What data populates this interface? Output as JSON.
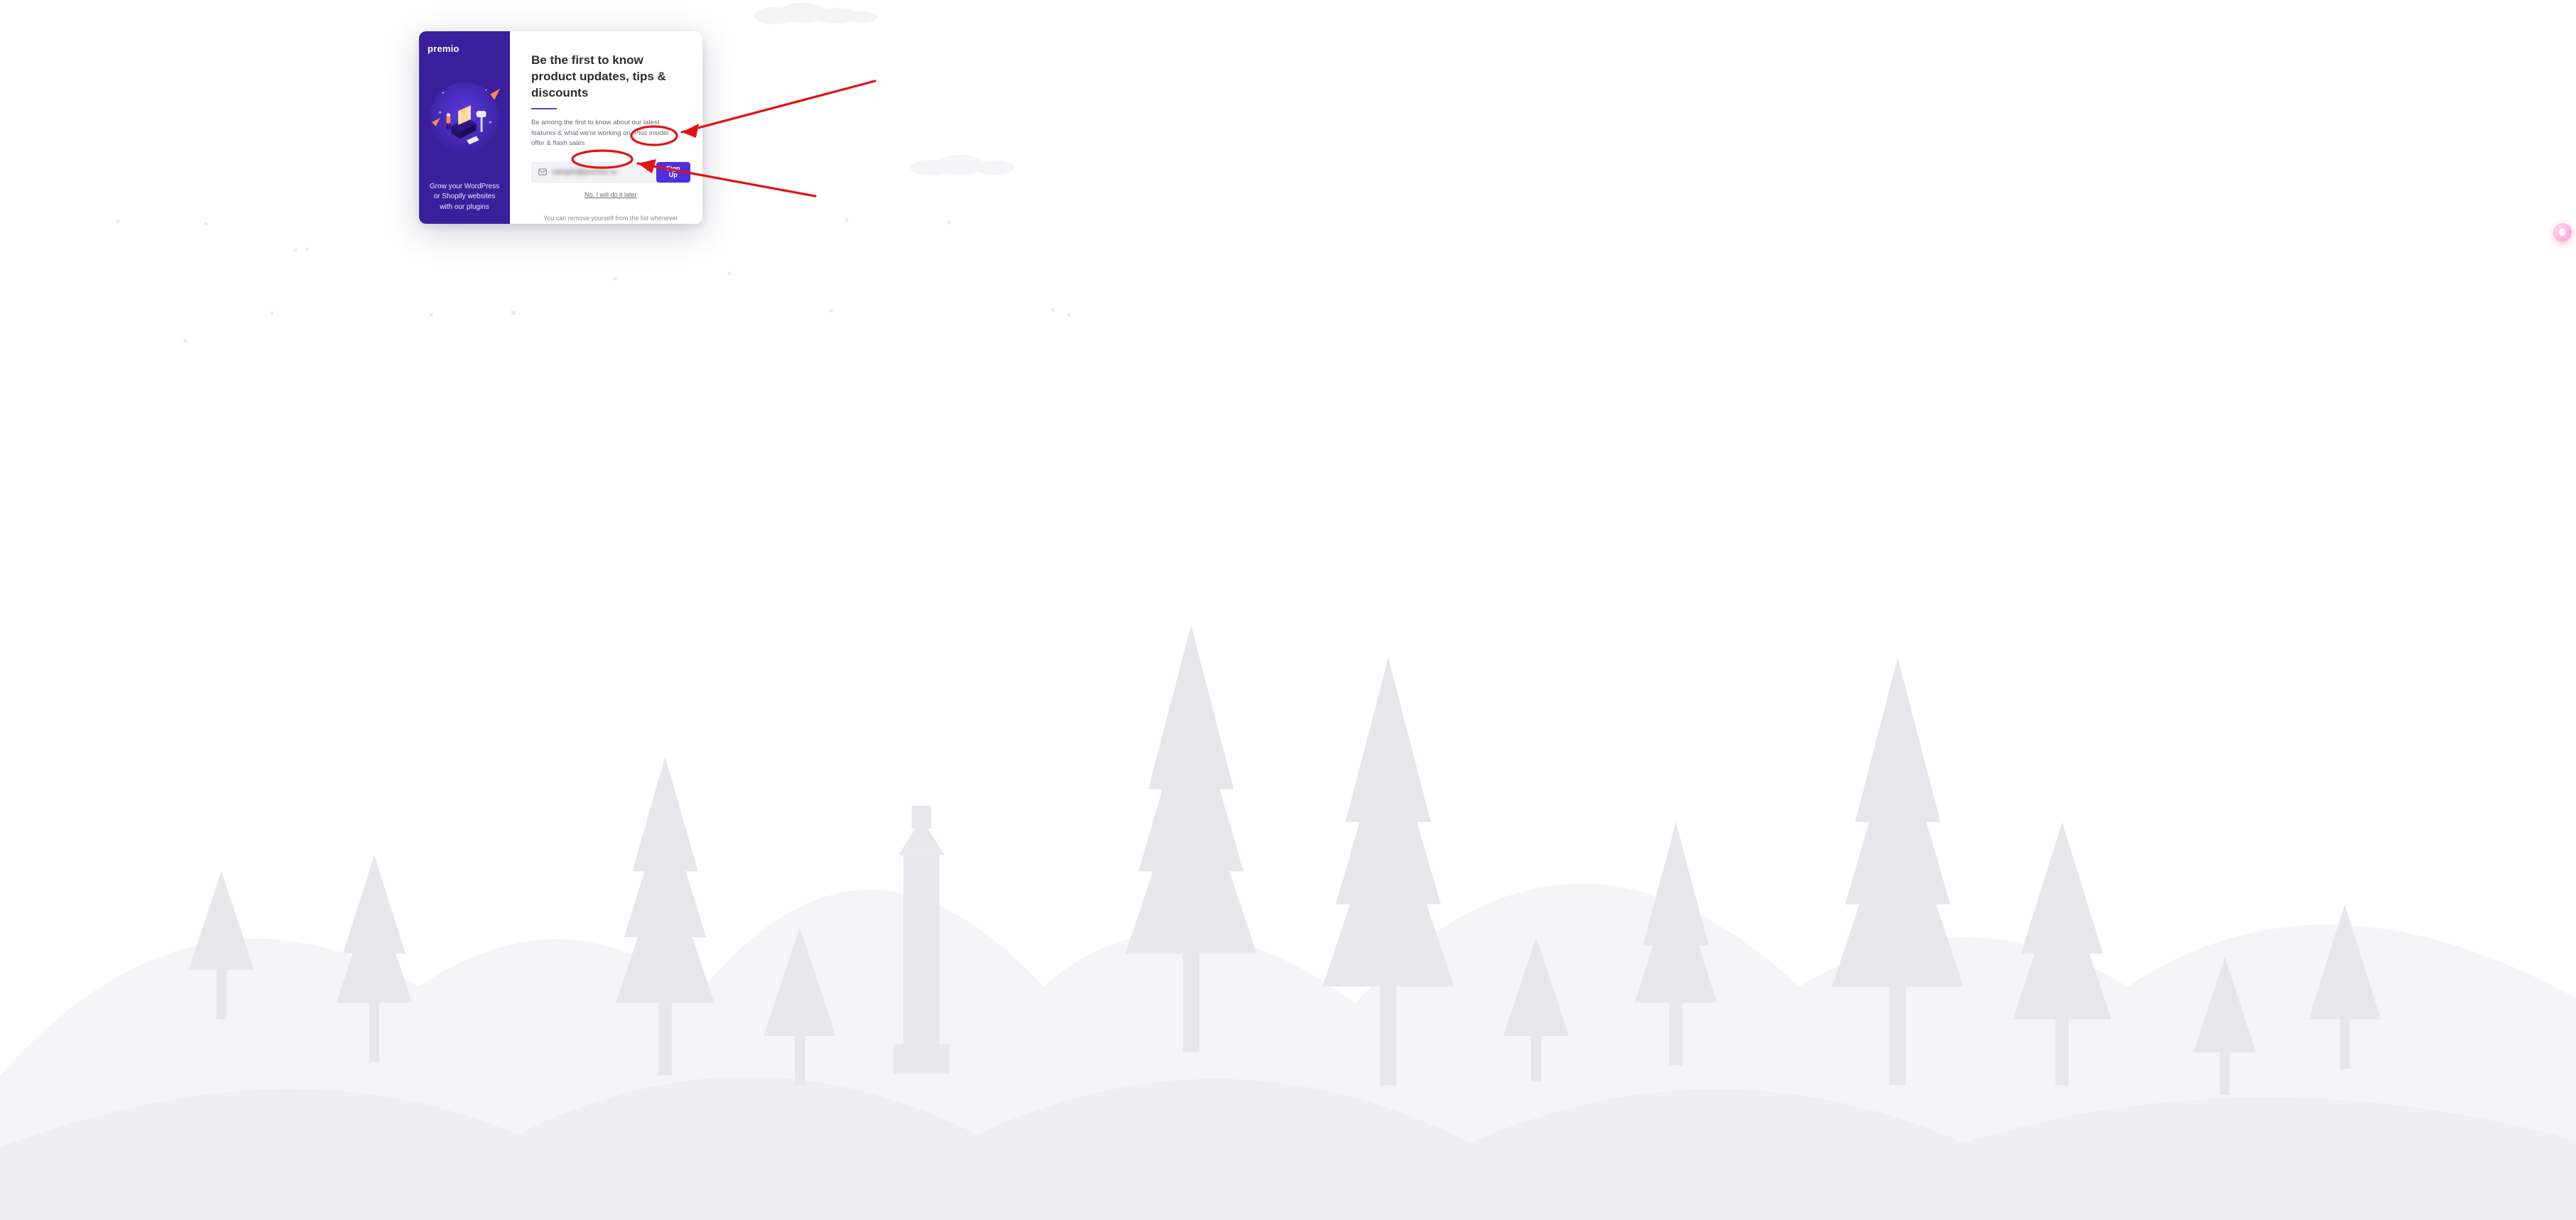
{
  "brand": "premio",
  "left_tagline": "Grow your WordPress or Shopify websites with our plugins",
  "right": {
    "title": "Be the first to know product updates, tips & discounts",
    "desc": "Be among the first to know about our latest features & what we're working on. Plus insider offer & flash sales",
    "email_value": "sample@premio.io",
    "signup_label": "Sign Up",
    "later_label": "No, I will do it later",
    "footer": "You can remove yourself from the list whenever you want, no strings attached"
  },
  "icons": {
    "mail": "mail-icon",
    "help": "help-icon"
  },
  "colors": {
    "brand_purple": "#3b1e9c",
    "accent": "#4f2fe0",
    "annotation": "#e11313"
  },
  "annotations": {
    "type": "hand-drawn-red",
    "targets": [
      "Sign Up button",
      "No, I will do it later link"
    ]
  }
}
